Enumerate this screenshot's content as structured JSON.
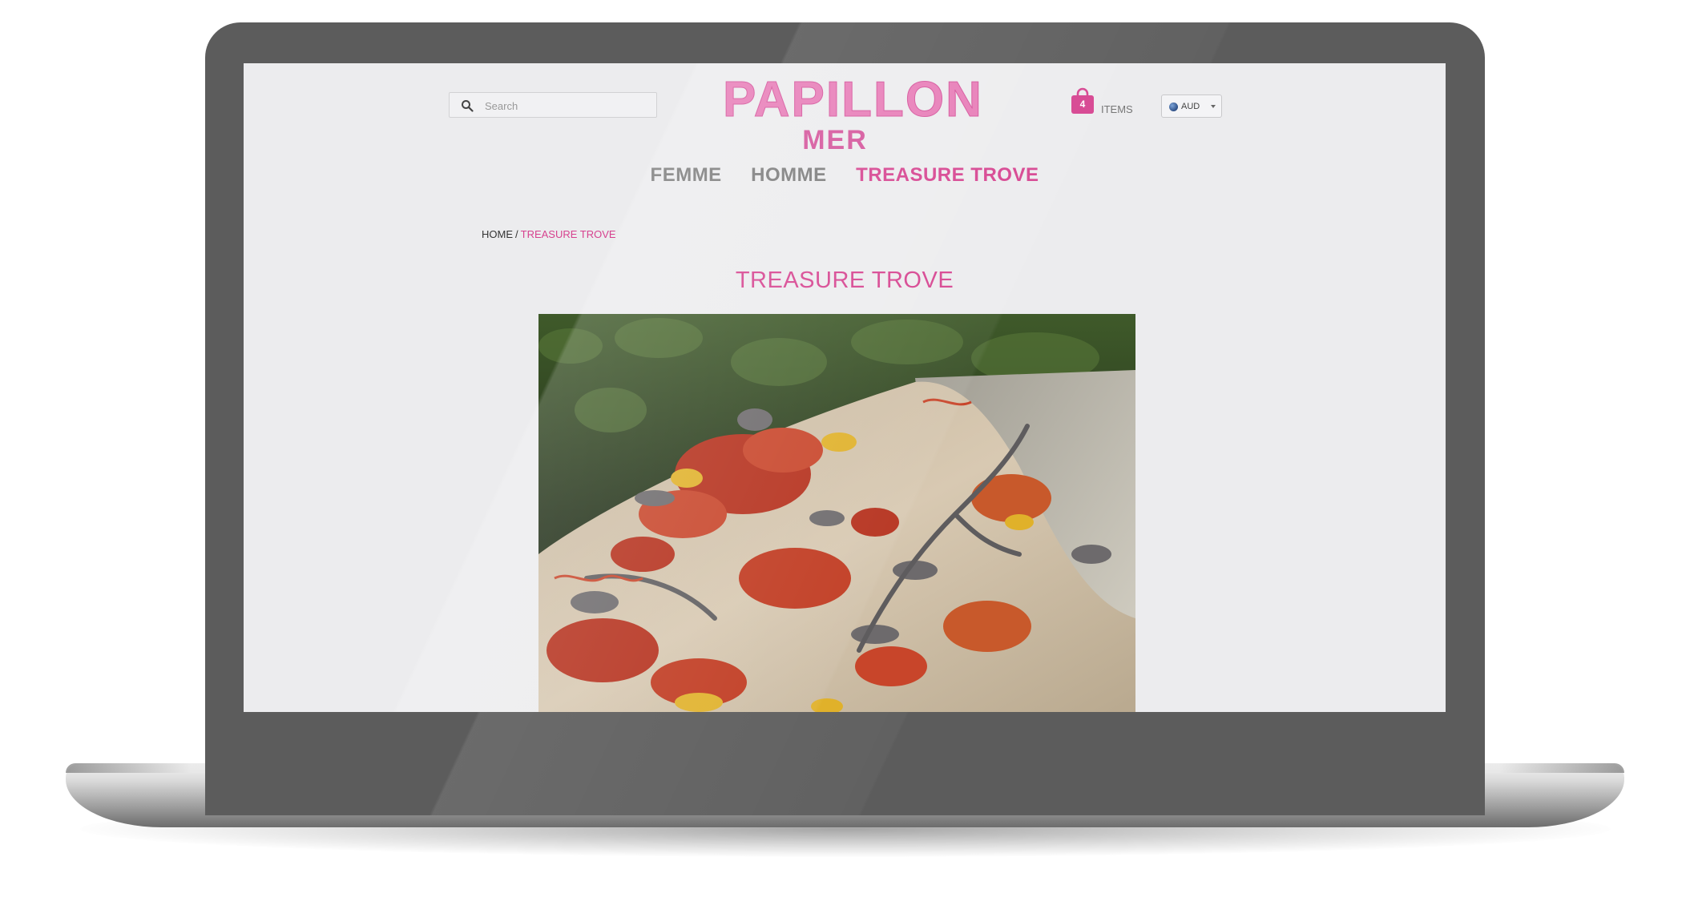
{
  "header": {
    "search_placeholder": "Search",
    "logo_main": "PAPILLON",
    "logo_sub": "MER",
    "cart_count": "4",
    "cart_label": "ITEMS",
    "currency": "AUD"
  },
  "nav": {
    "items": [
      {
        "label": "FEMME"
      },
      {
        "label": "HOMME"
      },
      {
        "label": "TREASURE TROVE"
      }
    ],
    "active_index": 2
  },
  "breadcrumb": {
    "home": "HOME",
    "separator": "/",
    "current": "TREASURE TROVE"
  },
  "page": {
    "title": "TREASURE TROVE"
  },
  "hero": {
    "subject": "embroidered-cushion-photo"
  },
  "colors": {
    "accent": "#d6428f",
    "logo": "#e77ab6",
    "nav_text": "#7a7a7a",
    "screen_bg": "#ececee",
    "bezel": "#5c5c5c"
  }
}
